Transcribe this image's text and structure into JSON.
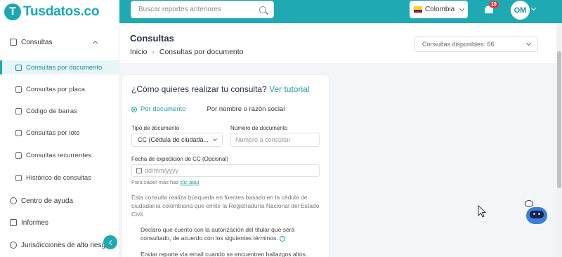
{
  "brand": {
    "logo_letter": "T",
    "name": "Tusdatos.co"
  },
  "search": {
    "placeholder": "Buscar reportes anteriores"
  },
  "country": {
    "label": "Colombia"
  },
  "notifications": {
    "count": "10"
  },
  "user": {
    "initials": "OM"
  },
  "colors": {
    "accent": "#1fa9b2",
    "title": "#2c2c54",
    "badge": "#e53a40"
  },
  "sidebar": {
    "consultas": "Consultas",
    "sub": [
      {
        "label": "Consultas por documento",
        "icon": "id-card-icon"
      },
      {
        "label": "Consultas por placa",
        "icon": "car-icon"
      },
      {
        "label": "Código de barras",
        "icon": "barcode-icon"
      },
      {
        "label": "Consultas por lote",
        "icon": "file-icon"
      },
      {
        "label": "Consultas recurrentes",
        "icon": "layers-icon"
      },
      {
        "label": "Histórico de consultas",
        "icon": "file-list-icon"
      }
    ],
    "help": "Centro de ayuda",
    "reports": "Informes",
    "risk": "Jurisdicciones de alto riesgo"
  },
  "page": {
    "title": "Consultas",
    "breadcrumb_home": "Inicio",
    "breadcrumb_sep": "›",
    "breadcrumb_current": "Consultas por documento",
    "available": "Consultas disponibles: 66"
  },
  "form": {
    "question": "¿Cómo quieres realizar tu consulta?",
    "tutorial": "Ver tutorial",
    "radio_document": "Por documento",
    "radio_name": "Por nombre o razón social",
    "doc_type_label": "Tipo de documento",
    "doc_type_value": "CC (Cédula de ciudada...",
    "doc_number_label": "Número de documento",
    "doc_number_placeholder": "Número a consultar",
    "date_label": "Fecha de expedición de CC (Opcional)",
    "date_placeholder": "dd/mm/yyyy",
    "help_prefix": "Para saber más haz ",
    "help_link": "clic aquí",
    "description": "Esta consulta realiza búsqueda en fuentes basado en la cédula de ciudadanía colombiana que emite la Registraduría Nacional del Estado Civil.",
    "consent": "Declaro que cuento con la autorización del titular que será consultado, de acuerdo con los siguientes términos.",
    "email_report": "Enviar reporte vía email cuando se encuentren hallazgos altos."
  }
}
